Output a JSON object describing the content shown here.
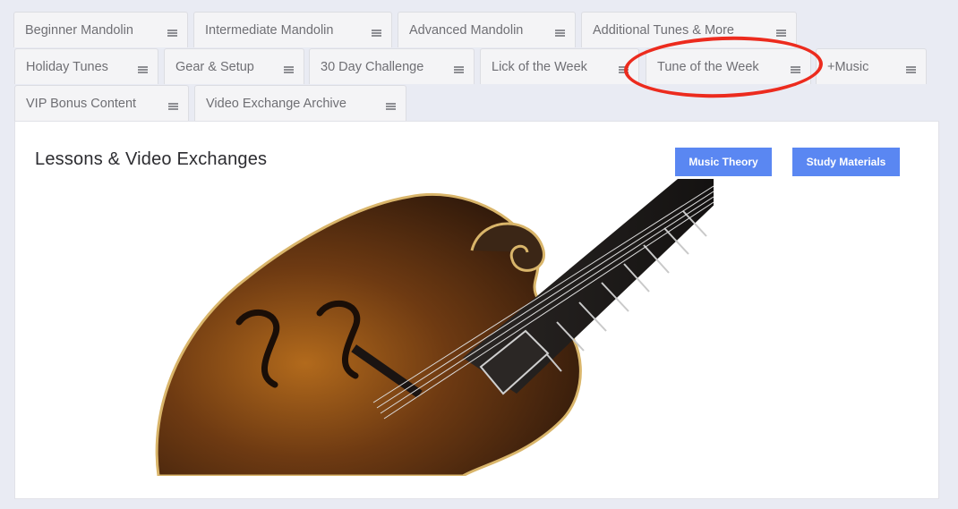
{
  "tabs": {
    "row1": [
      {
        "label": "Beginner Mandolin"
      },
      {
        "label": "Intermediate Mandolin"
      },
      {
        "label": "Advanced Mandolin"
      },
      {
        "label": "Additional Tunes & More"
      }
    ],
    "row2": [
      {
        "label": "Holiday Tunes"
      },
      {
        "label": "Gear & Setup"
      },
      {
        "label": "30 Day Challenge"
      },
      {
        "label": "Lick of the Week"
      },
      {
        "label": "Tune of the Week"
      },
      {
        "label": "+Music"
      }
    ],
    "row3": [
      {
        "label": "VIP Bonus Content"
      },
      {
        "label": "Video Exchange Archive"
      }
    ]
  },
  "panel": {
    "title": "Lessons & Video Exchanges",
    "buttons": {
      "music_theory": "Music Theory",
      "study_materials": "Study Materials"
    }
  },
  "colors": {
    "accent_button": "#5a87f2",
    "annotation": "#ec2b1e",
    "background": "#e9ebf3"
  },
  "icons": {
    "tab_menu": "hamburger-menu-icon"
  }
}
